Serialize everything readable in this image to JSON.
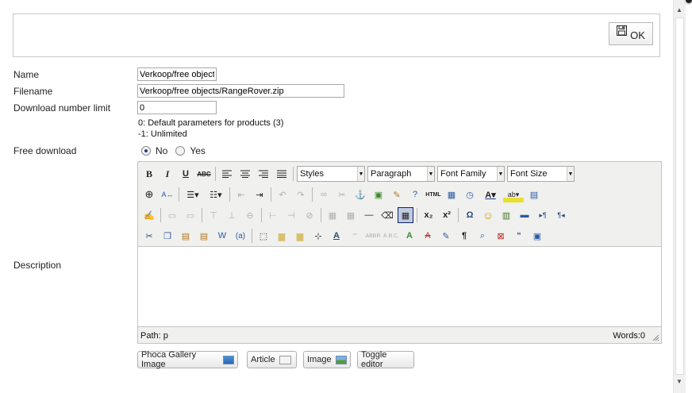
{
  "ok_button": {
    "label": "OK",
    "icon": "floppy-disk-icon"
  },
  "form": {
    "name": {
      "label": "Name",
      "value": "Verkoop/free objects."
    },
    "filename": {
      "label": "Filename",
      "value": "Verkoop/free objects/RangeRover.zip"
    },
    "download_limit": {
      "label": "Download number limit",
      "value": "0",
      "hint1": "0: Default parameters for products (3)",
      "hint2": "-1: Unlimited"
    },
    "free_download": {
      "label": "Free download",
      "options": [
        "No",
        "Yes"
      ],
      "selected": "No"
    },
    "description": {
      "label": "Description"
    }
  },
  "editor": {
    "dropdowns": {
      "styles": "Styles",
      "paragraph": "Paragraph",
      "font_family": "Font Family",
      "font_size": "Font Size"
    },
    "status_path": "Path: p",
    "word_count": "Words:0"
  },
  "buttons": {
    "phoca": "Phoca Gallery Image",
    "article": "Article",
    "image": "Image",
    "toggle": "Toggle editor"
  },
  "colors": {
    "accent": "#1a3f8f",
    "toolbar_bg": "#f0f0ee",
    "border": "#c4c4c4"
  }
}
